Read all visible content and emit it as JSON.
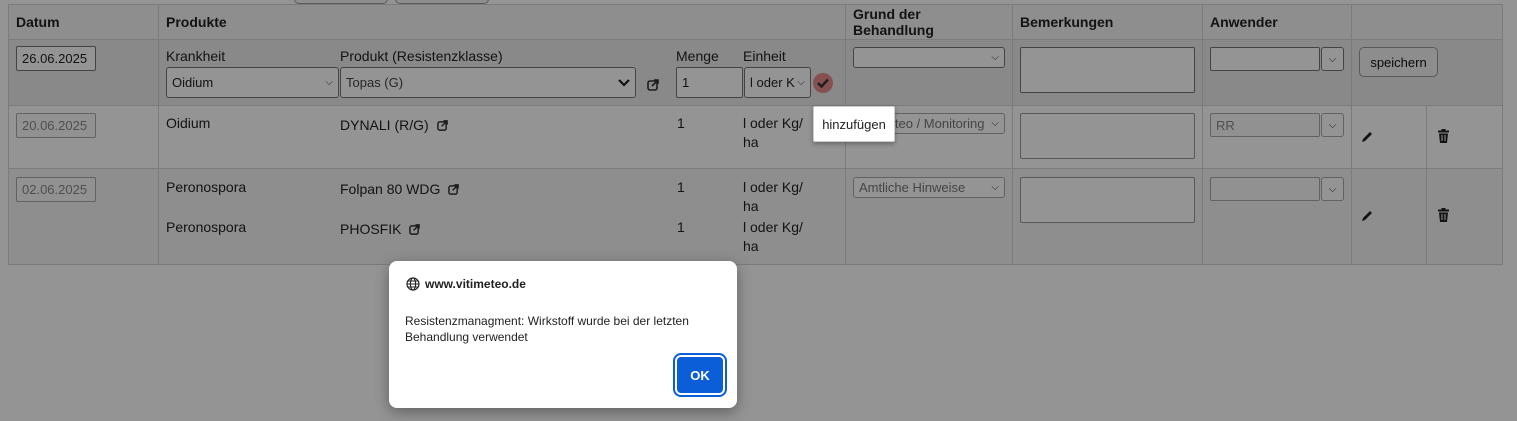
{
  "headers": {
    "date": "Datum",
    "products": "Produkte",
    "reason": "Grund der Behandlung",
    "remarks": "Bemerkungen",
    "user": "Anwender"
  },
  "form": {
    "date_value": "26.06.2025",
    "disease_label": "Krankheit",
    "disease_value": "Oidium",
    "product_label": "Produkt (Resistenzklasse)",
    "product_value": "Topas (G)",
    "amount_label": "Menge",
    "amount_value": "1",
    "unit_label": "Einheit",
    "unit_value": "l oder K",
    "reason_value": "",
    "remarks_value": "",
    "user_value": "",
    "save_label": "speichern",
    "add_tooltip": "hinzufügen"
  },
  "rows": [
    {
      "date": "20.06.2025",
      "items": [
        {
          "disease": "Oidium",
          "product": "DYNALI (R/G)",
          "amount": "1",
          "unit_line1": "l oder Kg/",
          "unit_line2": "ha"
        }
      ],
      "reason": "Vitimeteo / Monitoring",
      "reason_visible": "eo / Monitoring",
      "user": "RR"
    },
    {
      "date": "02.06.2025",
      "items": [
        {
          "disease": "Peronospora",
          "product": "Folpan 80 WDG",
          "amount": "1",
          "unit_line1": "l oder Kg/",
          "unit_line2": "ha"
        },
        {
          "disease": "Peronospora",
          "product": "PHOSFIK",
          "amount": "1",
          "unit_line1": "l oder Kg/",
          "unit_line2": "ha"
        }
      ],
      "reason": "Amtliche Hinweise",
      "user": ""
    }
  ],
  "dialog": {
    "site": "www.vitimeteo.de",
    "message": "Resistenzmanagment: Wirkstoff wurde bei der letzten Behandlung verwendet",
    "ok_label": "OK"
  },
  "colors": {
    "ok_button": "#0b5ed7",
    "overlay": "rgba(0,0,0,0.42)"
  }
}
